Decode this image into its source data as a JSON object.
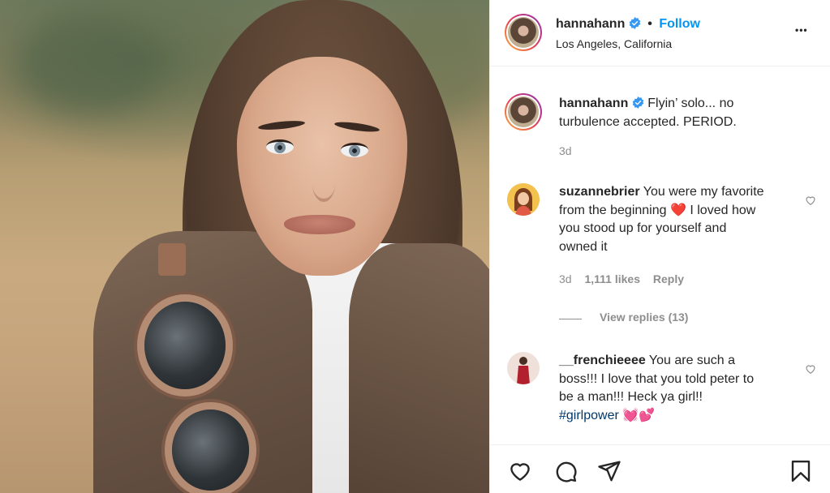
{
  "header": {
    "username": "hannahann",
    "separator": "•",
    "follow_label": "Follow",
    "location": "Los Angeles, California",
    "more_label": "•••"
  },
  "caption": {
    "username": "hannahann",
    "text_line1": "Flyin’ solo... no",
    "text_line2": "turbulence accepted. PERIOD.",
    "time": "3d"
  },
  "comments": [
    {
      "username": "suzannebrier",
      "line1": "You were my favorite",
      "line2_pre": "from the beginning",
      "emoji": "❤️",
      "line2_post": "I loved how",
      "line3": "you stood up for yourself and",
      "line4": "owned it",
      "time": "3d",
      "likes": "1,111 likes",
      "reply_label": "Reply",
      "view_replies": "View replies (13)"
    },
    {
      "username": "__frenchieeee",
      "line1": "You are such a",
      "line2": "boss!!! I love that you told peter to",
      "line3": "be a man!!! Heck ya girl!!",
      "hashtag": "#girlpower",
      "emoji": "💓💕"
    }
  ],
  "actions": {
    "like": "heart-icon",
    "comment": "comment-icon",
    "share": "share-icon",
    "save": "bookmark-icon"
  },
  "colors": {
    "accent": "#0095f6",
    "verified": "#3897f0",
    "muted": "#8e8e8e",
    "hashtag": "#00376b"
  }
}
